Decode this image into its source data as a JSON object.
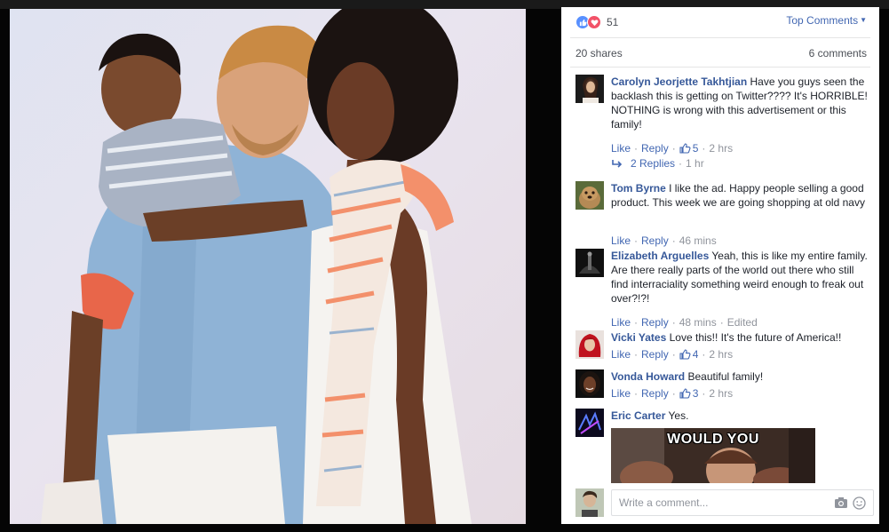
{
  "photo": {
    "alt": ""
  },
  "sidebar": {
    "reaction_count": "51",
    "sort_label": "Top Comments",
    "shares": "20 shares",
    "comments_count": "6 comments",
    "comments": [
      {
        "author": "Carolyn Jeorjette Takhtjian",
        "text": "Have you guys seen the backlash this is getting on Twitter???? It's HORRIBLE! NOTHING is wrong with this advertisement or this family!",
        "like": "Like",
        "reply": "Reply",
        "likes": "5",
        "time": "2 hrs",
        "replies_label": "2 Replies",
        "replies_time": "1 hr"
      },
      {
        "author": "Tom Byrne",
        "text": "I like the ad. Happy people selling a good product. This week we are going shopping at old navy",
        "like": "Like",
        "reply": "Reply",
        "time": "46 mins"
      },
      {
        "author": "Elizabeth Arguelles",
        "text": "Yeah, this is like my entire family. Are there really parts of the world out there who still find interraciality something weird enough to freak out over?!?!",
        "like": "Like",
        "reply": "Reply",
        "time": "48 mins",
        "edited": "Edited"
      },
      {
        "author": "Vicki Yates",
        "text": "Love this!! It's the future of America!!",
        "like": "Like",
        "reply": "Reply",
        "likes": "4",
        "time": "2 hrs"
      },
      {
        "author": "Vonda Howard",
        "text": "Beautiful family!",
        "like": "Like",
        "reply": "Reply",
        "likes": "3",
        "time": "2 hrs"
      },
      {
        "author": "Eric Carter",
        "text": "Yes.",
        "gif_text": "WOULD YOU"
      }
    ],
    "composer": {
      "placeholder": "Write a comment..."
    }
  },
  "colors": {
    "link_blue": "#365899",
    "action_blue": "#4267b2",
    "like_reaction": "#5890ff",
    "love_reaction": "#f25268",
    "meta_gray": "#90949c"
  },
  "icons": [
    "like-reaction-icon",
    "love-reaction-icon",
    "caret-down-icon",
    "reply-arrow-icon",
    "thumbs-up-icon",
    "camera-icon",
    "smiley-icon"
  ]
}
